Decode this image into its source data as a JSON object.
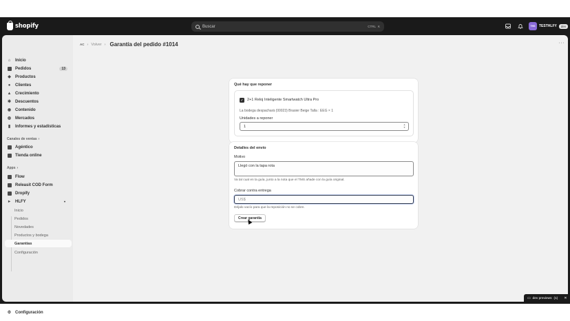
{
  "topbar": {
    "brand": "shopify",
    "search_placeholder": "Buscar",
    "shortcut_ctrl": "CTRL",
    "shortcut_key": "K",
    "avatar_initials": "THS",
    "store_name": "TESTHLFY",
    "store_tag": "dev"
  },
  "sidebar": {
    "main_items": [
      {
        "label": "Inicio",
        "icon": "home-icon"
      },
      {
        "label": "Pedidos",
        "icon": "orders-icon",
        "badge": "13"
      },
      {
        "label": "Productos",
        "icon": "tag-icon"
      },
      {
        "label": "Clientes",
        "icon": "person-icon"
      },
      {
        "label": "Crecimiento",
        "icon": "growth-icon"
      },
      {
        "label": "Descuentos",
        "icon": "discount-icon"
      },
      {
        "label": "Contenido",
        "icon": "content-icon"
      },
      {
        "label": "Mercados",
        "icon": "globe-icon"
      },
      {
        "label": "Informes y estadísticas",
        "icon": "chart-icon"
      }
    ],
    "sales_channels_header": "Canales de ventas",
    "sales_channels": [
      {
        "label": "Agéntico",
        "icon": "agentic-icon"
      },
      {
        "label": "Tienda online",
        "icon": "store-icon"
      }
    ],
    "apps_header": "Apps",
    "apps": [
      {
        "label": "Flow",
        "icon": "flow-icon"
      },
      {
        "label": "Releasit COD Form",
        "icon": "releasit-icon"
      },
      {
        "label": "Dropify",
        "icon": "dropify-icon"
      },
      {
        "label": "HLFY",
        "icon": "hlfy-icon"
      }
    ],
    "hlfy_subitems": [
      "Inicio",
      "Pedidos",
      "Novedades",
      "Productos y bodega",
      "Garantías",
      "Configuración"
    ],
    "settings": "Configuración"
  },
  "header": {
    "home_crumb": "AC",
    "back": "Volver",
    "title": "Garantía del pedido #1014",
    "more": "···"
  },
  "replace_card": {
    "title": "Qué hay que reponer",
    "item_checkbox": "✓",
    "item_name": "2+1 Reloj Inteligente Smartwatch Ultra Pro",
    "warehouse_line": "La bodega despachará (00023) Brasier Beige Talla : EEG × 1",
    "qty_label": "Unidades a reponer",
    "qty_value": "1"
  },
  "shipping_card": {
    "title": "Detalles del envío",
    "reason_label": "Motivo",
    "reason_value": "Llegó con la tapa rota",
    "reason_help": "Va tal cual en la guía, junto a la nota que el TMS añade con la guía original.",
    "cod_label": "Cobrar contra entrega",
    "cod_value": "US$",
    "cod_help": "Déjalo vacío para que la reposición no se cobre.",
    "submit": "Crear garantía"
  },
  "dev_pill": {
    "label": "dev previews",
    "count": "(1)",
    "close": "✕"
  },
  "colors": {
    "topbar": "#1a1a1a",
    "sidebar": "#ebebeb",
    "main_bg": "#f1f1f1",
    "focus_ring": "#303a4e"
  }
}
